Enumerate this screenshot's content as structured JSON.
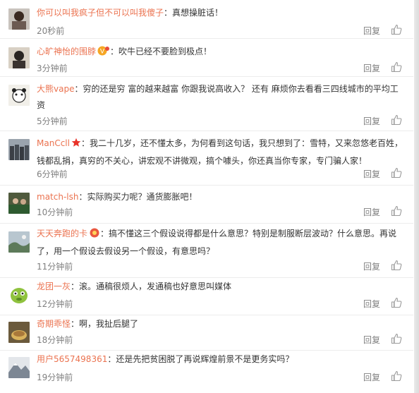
{
  "comments": [
    {
      "username": "你可以叫我疯子但不可以叫我傻子",
      "text": "真想操脏话！",
      "time": "20秒前",
      "reply": "回复",
      "badge": ""
    },
    {
      "username": "心旷神怡的围脖",
      "text": "吹牛已经不要脸到极点！",
      "time": "3分钟前",
      "reply": "回复",
      "badge": "vip"
    },
    {
      "username": "大熊vape",
      "text": "穷的还是穷  富的越来越富 你跟我说高收入？  还有 麻烦你去看看三四线城市的平均工资",
      "time": "5分钟前",
      "reply": "回复",
      "badge": ""
    },
    {
      "username": "ManCcll",
      "text": "我二十几岁，还不懂太多，为何看到这句话，我只想到了：雪特，又来忽悠老百姓，钱都乱捐，真穷的不关心，讲宏观不讲微观，搞个噱头，你还真当你专家，专门骗人家！",
      "time": "6分钟前",
      "reply": "回复",
      "badge": "star"
    },
    {
      "username": "match-lsh",
      "text": "实际购买力呢？通货膨胀吧！",
      "time": "10分钟前",
      "reply": "回复",
      "badge": ""
    },
    {
      "username": "天天奔跑的卡",
      "text": "搞不懂这三个假设说得都是什么意思？特别是制服断层波动？什么意思。再说了，用一个假设去假设另一个假设，有意思吗？",
      "time": "11分钟前",
      "reply": "回复",
      "badge": "red"
    },
    {
      "username": "龙团一灰",
      "text": "滚。通稿很烦人，发通稿也好意思叫媒体",
      "time": "12分钟前",
      "reply": "回复",
      "badge": ""
    },
    {
      "username": "奇期乖怪",
      "text": "啊，我扯后腿了",
      "time": "18分钟前",
      "reply": "回复",
      "badge": ""
    },
    {
      "username": "用户5657498361",
      "text": "还是先把贫困脱了再说辉煌前景不是更务实吗？",
      "time": "19分钟前",
      "reply": "回复",
      "badge": ""
    }
  ]
}
